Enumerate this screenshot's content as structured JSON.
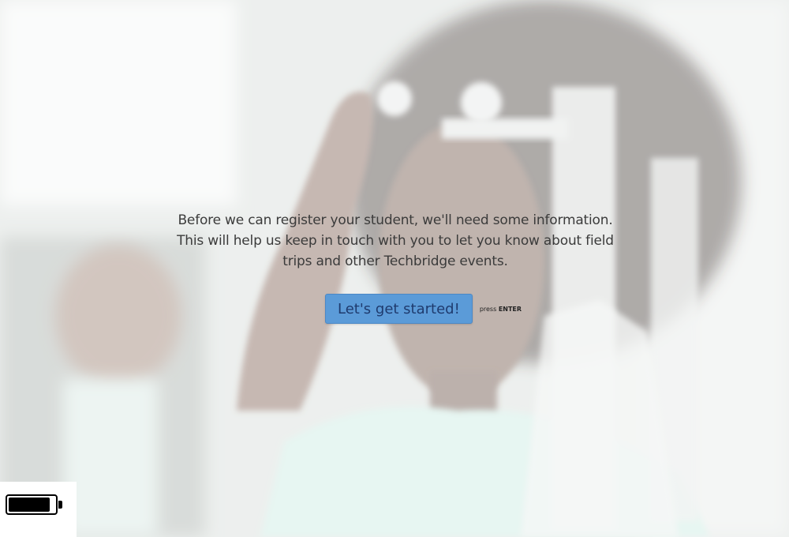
{
  "intro": {
    "message": "Before we can register your student, we'll need some information. This will help us keep in touch with you to let you know about field trips and other Techbridge events."
  },
  "cta": {
    "button_label": "Let's get started!",
    "hint_prefix": "press",
    "hint_key": "ENTER"
  },
  "battery": {
    "level": 0.9
  },
  "colors": {
    "button": "#5b9bd8",
    "button_text": "#1f3b6e",
    "text": "#3b3b3b"
  }
}
